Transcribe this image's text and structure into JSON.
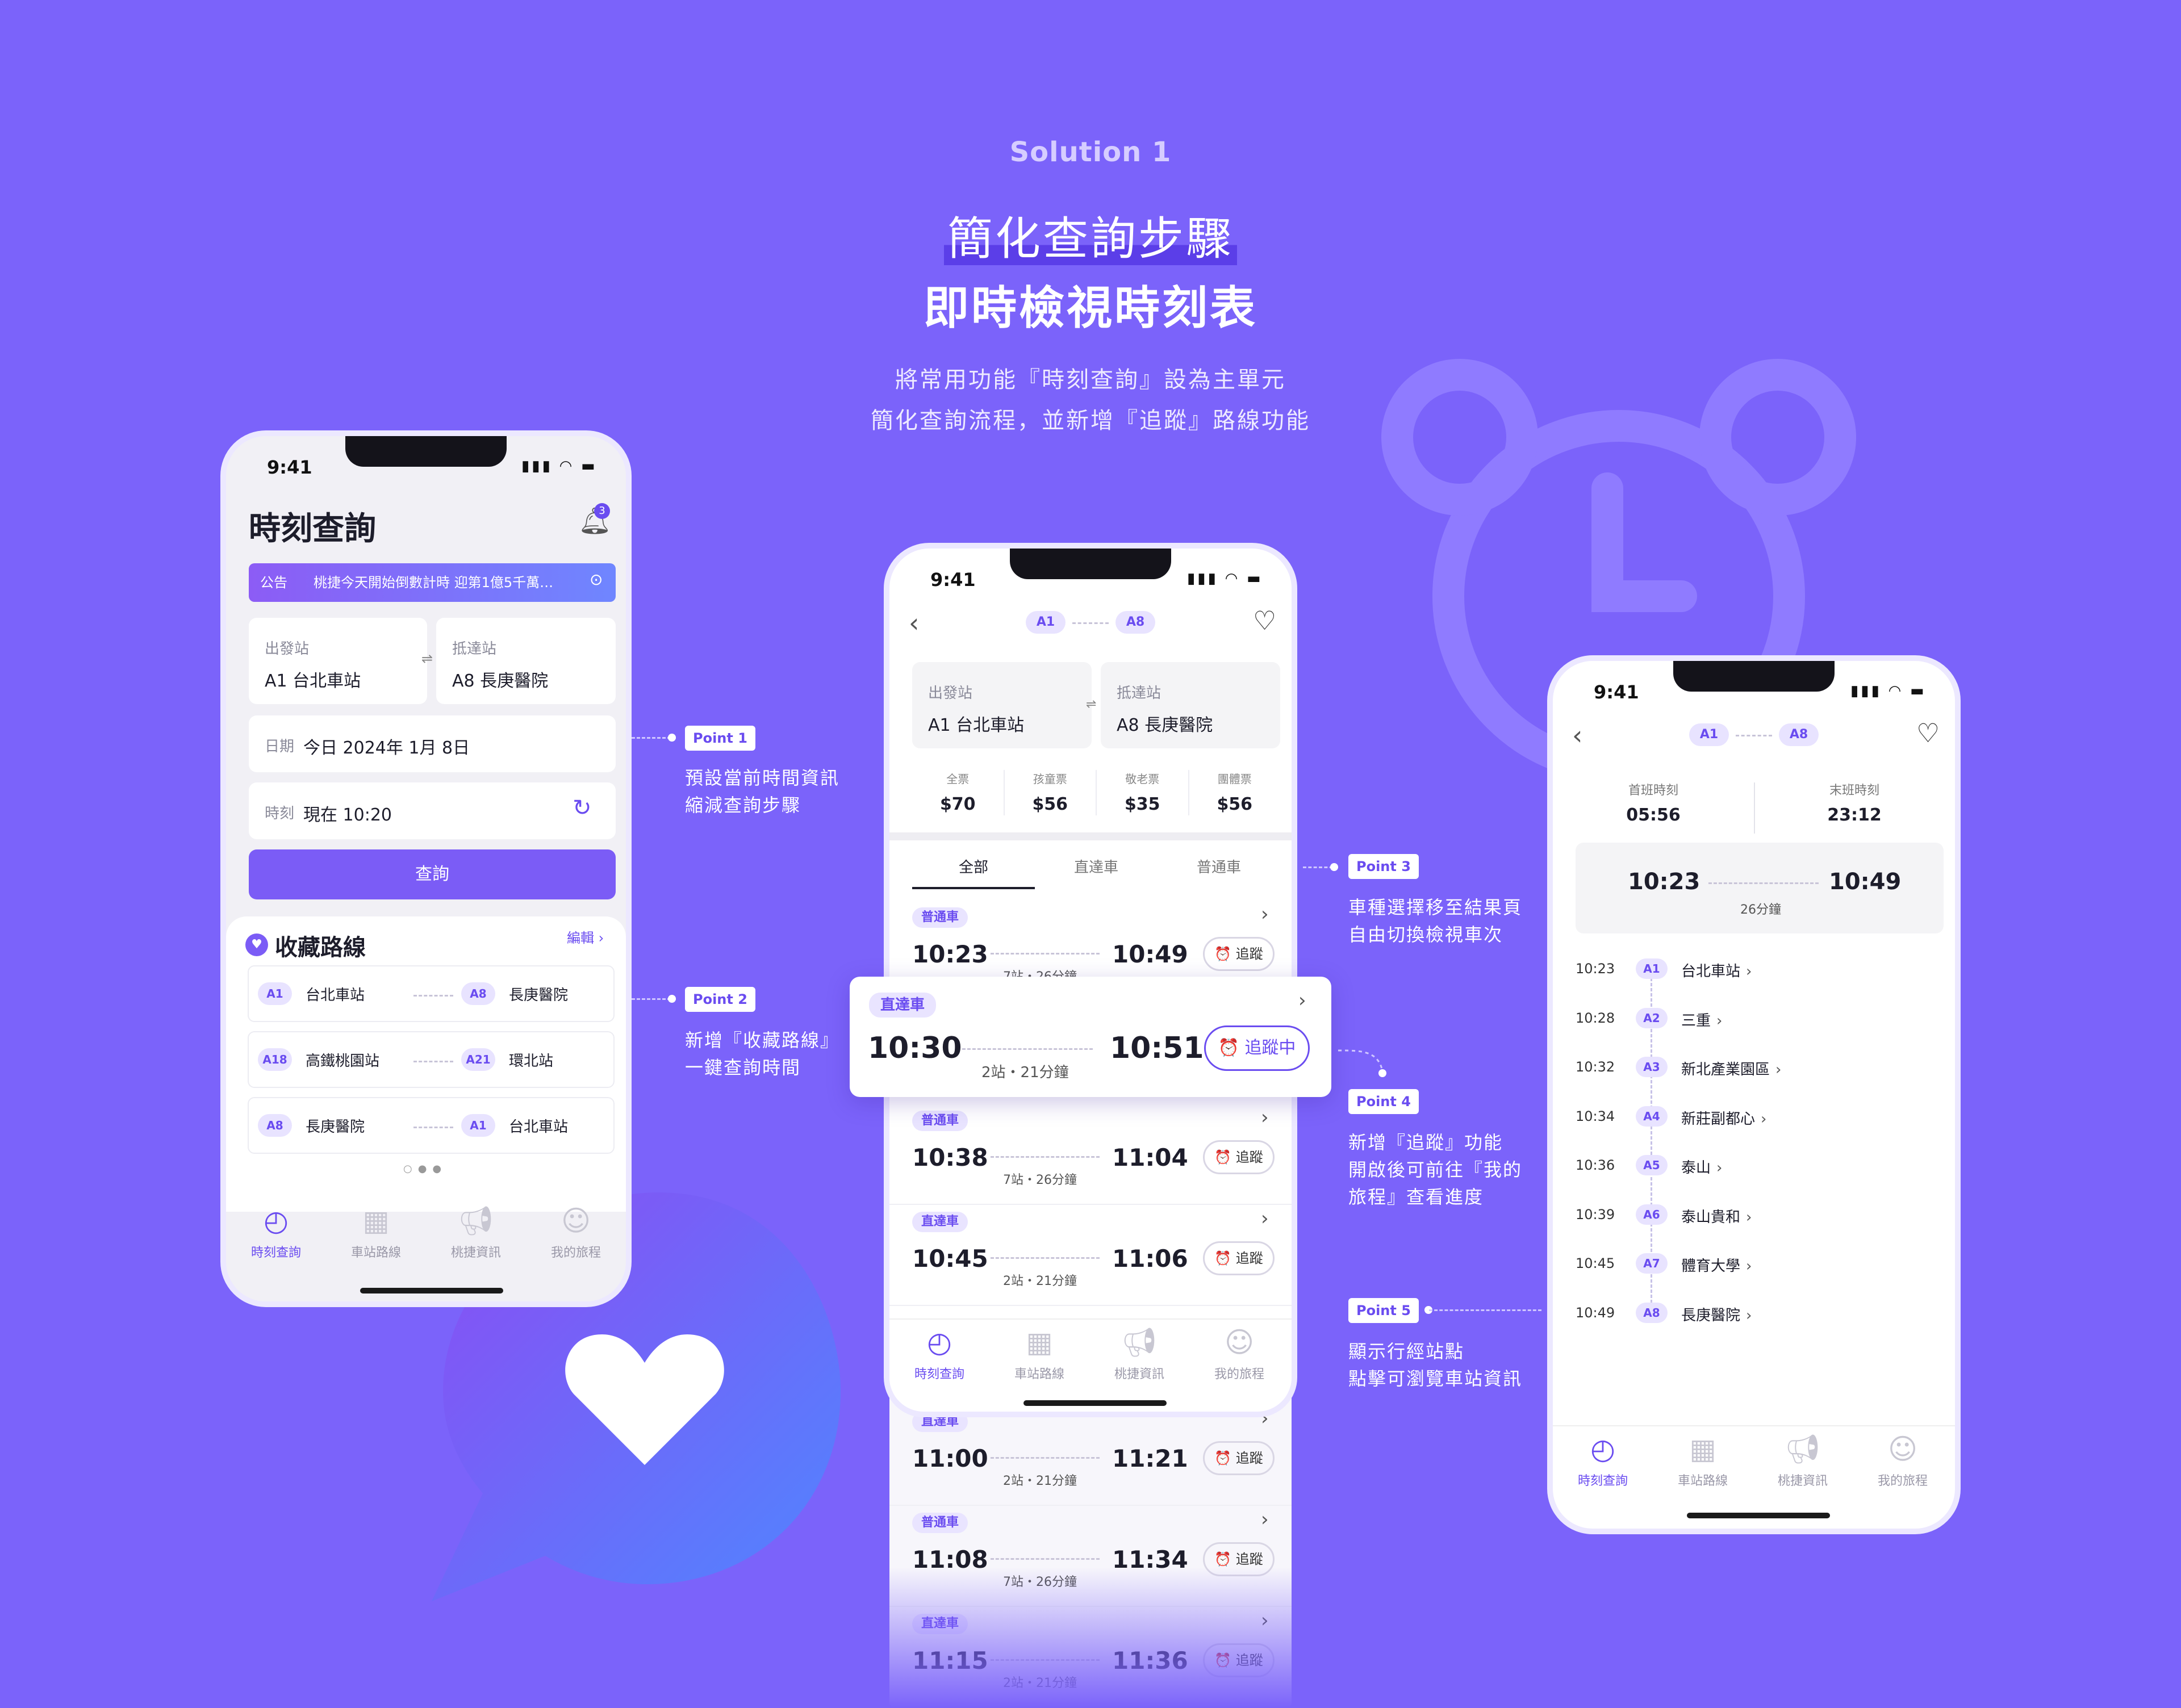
{
  "header": {
    "solution": "Solution 1",
    "title1": "簡化查詢步驟",
    "title2": "即時檢視時刻表",
    "sub1": "將常用功能『時刻查詢』設為主單元",
    "sub2": "簡化查詢流程，並新增『追蹤』路線功能"
  },
  "status": {
    "time": "9:41"
  },
  "nav": {
    "t1": "時刻查詢",
    "t2": "車站路線",
    "t3": "桃捷資訊",
    "t4": "我的旅程"
  },
  "p1": {
    "title": "時刻查詢",
    "badge": "3",
    "notice_tag": "公告",
    "notice": "桃捷今天開始倒數計時 迎第1億5千萬…",
    "dep_label": "出發站",
    "dep": "A1 台北車站",
    "arr_label": "抵達站",
    "arr": "A8 長庚醫院",
    "date_label": "日期",
    "date": "今日 2024年 1月 8日",
    "time_label": "時刻",
    "time": "現在 10:20",
    "search": "查詢",
    "fav_title": "收藏路線",
    "edit": "編輯",
    "favs": [
      {
        "a": "A1",
        "an": "台北車站",
        "b": "A8",
        "bn": "長庚醫院"
      },
      {
        "a": "A18",
        "an": "高鐵桃園站",
        "b": "A21",
        "bn": "環北站"
      },
      {
        "a": "A8",
        "an": "長庚醫院",
        "b": "A1",
        "bn": "台北車站"
      }
    ]
  },
  "p2": {
    "from": "A1",
    "to": "A8",
    "dep_label": "出發站",
    "dep": "A1 台北車站",
    "arr_label": "抵達站",
    "arr": "A8 長庚醫院",
    "fares": [
      {
        "l": "全票",
        "v": "$70"
      },
      {
        "l": "孩童票",
        "v": "$56"
      },
      {
        "l": "敬老票",
        "v": "$35"
      },
      {
        "l": "團體票",
        "v": "$56"
      }
    ],
    "tabs": [
      "全部",
      "直達車",
      "普通車"
    ],
    "trains": [
      {
        "type": "普通車",
        "dep": "10:23",
        "arr": "10:49",
        "info": "7站・26分鐘",
        "btn": "追蹤"
      },
      {
        "type": "直達車",
        "dep": "10:30",
        "arr": "10:51",
        "info": "2站・21分鐘",
        "btn": "追蹤中"
      },
      {
        "type": "普通車",
        "dep": "10:38",
        "arr": "11:04",
        "info": "7站・26分鐘",
        "btn": "追蹤"
      },
      {
        "type": "直達車",
        "dep": "10:45",
        "arr": "11:06",
        "info": "2站・21分鐘",
        "btn": "追蹤"
      },
      {
        "type": "直達車",
        "dep": "11:00",
        "arr": "11:21",
        "info": "2站・21分鐘",
        "btn": "追蹤"
      },
      {
        "type": "普通車",
        "dep": "11:08",
        "arr": "11:34",
        "info": "7站・26分鐘",
        "btn": "追蹤"
      },
      {
        "type": "直達車",
        "dep": "11:15",
        "arr": "11:36",
        "info": "2站・21分鐘",
        "btn": "追蹤"
      }
    ]
  },
  "p3": {
    "from": "A1",
    "to": "A8",
    "first_label": "首班時刻",
    "first": "05:56",
    "last_label": "末班時刻",
    "last": "23:12",
    "dep": "10:23",
    "arr": "10:49",
    "dur": "26分鐘",
    "stops": [
      {
        "t": "10:23",
        "c": "A1",
        "n": "台北車站"
      },
      {
        "t": "10:28",
        "c": "A2",
        "n": "三重"
      },
      {
        "t": "10:32",
        "c": "A3",
        "n": "新北產業園區"
      },
      {
        "t": "10:34",
        "c": "A4",
        "n": "新莊副都心"
      },
      {
        "t": "10:36",
        "c": "A5",
        "n": "泰山"
      },
      {
        "t": "10:39",
        "c": "A6",
        "n": "泰山貴和"
      },
      {
        "t": "10:45",
        "c": "A7",
        "n": "體育大學"
      },
      {
        "t": "10:49",
        "c": "A8",
        "n": "長庚醫院"
      }
    ]
  },
  "points": [
    {
      "tag": "Point 1",
      "l1": "預設當前時間資訊",
      "l2": "縮減查詢步驟"
    },
    {
      "tag": "Point 2",
      "l1": "新增『收藏路線』",
      "l2": "一鍵查詢時間"
    },
    {
      "tag": "Point 3",
      "l1": "車種選擇移至結果頁",
      "l2": "自由切換檢視車次"
    },
    {
      "tag": "Point 4",
      "l1": "新增『追蹤』功能",
      "l2": "開啟後可前往『我的",
      "l3": "旅程』查看進度"
    },
    {
      "tag": "Point 5",
      "l1": "顯示行經站點",
      "l2": "點擊可瀏覽車站資訊"
    }
  ],
  "colors": {
    "bg": "#7b63fa",
    "accent": "#6a4cf0"
  }
}
